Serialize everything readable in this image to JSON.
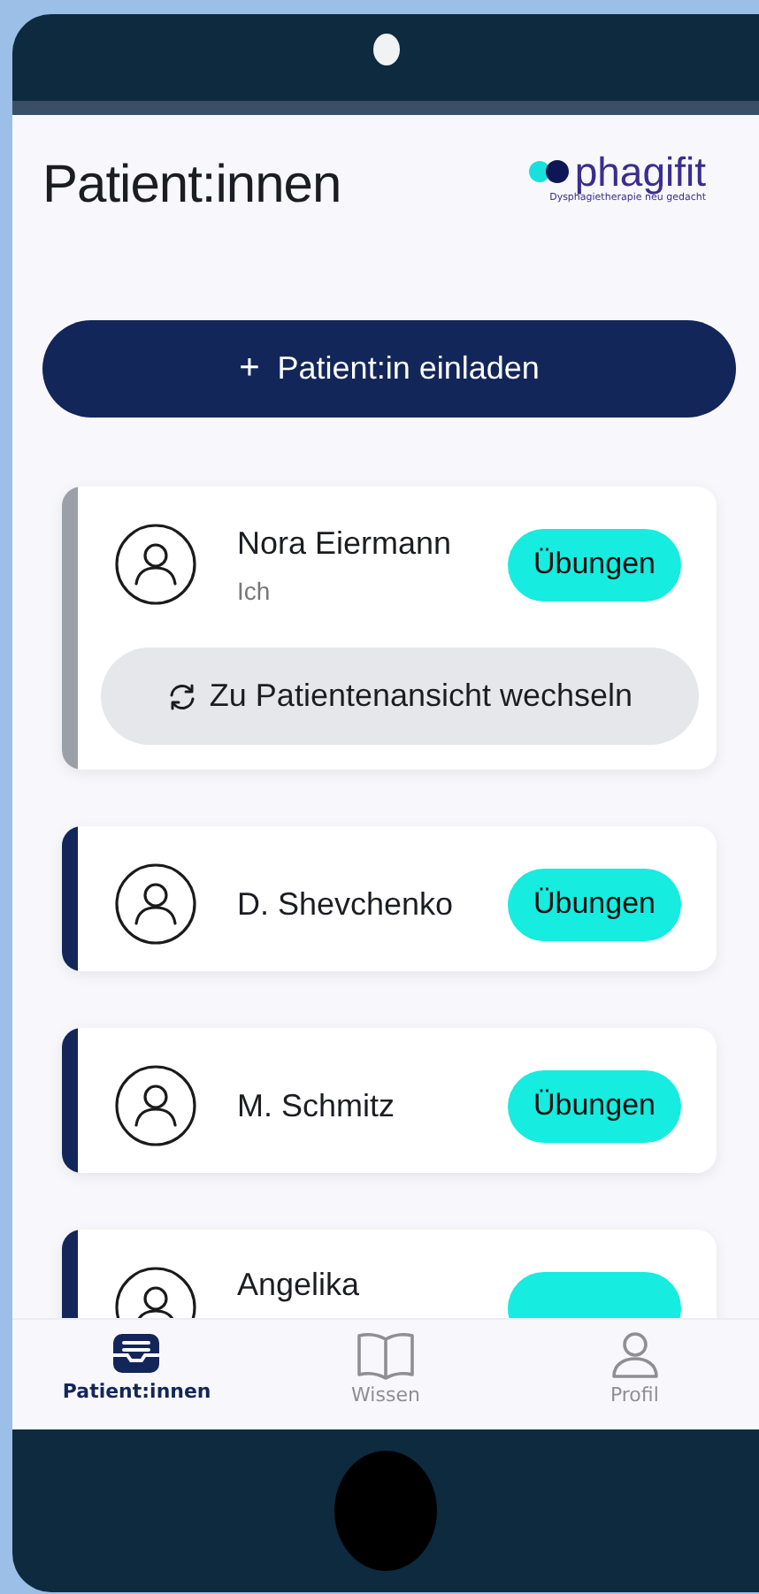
{
  "header": {
    "title": "Patient:innen",
    "logo": {
      "name": "phagifit",
      "tagline": "Dysphagietherapie neu gedacht"
    }
  },
  "invite_button": {
    "icon": "+",
    "label": "Patient:in einladen"
  },
  "patients": [
    {
      "name": "Nora Eiermann",
      "subtitle": "Ich",
      "color": "#9ba0a8",
      "action": "Übungen",
      "switch_button": "Zu Patientenansicht wechseln"
    },
    {
      "name": "D. Shevchenko",
      "color": "#13265a",
      "action": "Übungen"
    },
    {
      "name": "M. Schmitz",
      "color": "#13265a",
      "action": "Übungen"
    },
    {
      "name": "Angelika",
      "color": "#13265a"
    }
  ],
  "tab_bar": [
    {
      "label": "Patient:innen",
      "kind": "tray",
      "selected": true
    },
    {
      "label": "Wissen",
      "kind": "book",
      "selected": false
    },
    {
      "label": "Profil",
      "kind": "person",
      "selected": false
    }
  ]
}
